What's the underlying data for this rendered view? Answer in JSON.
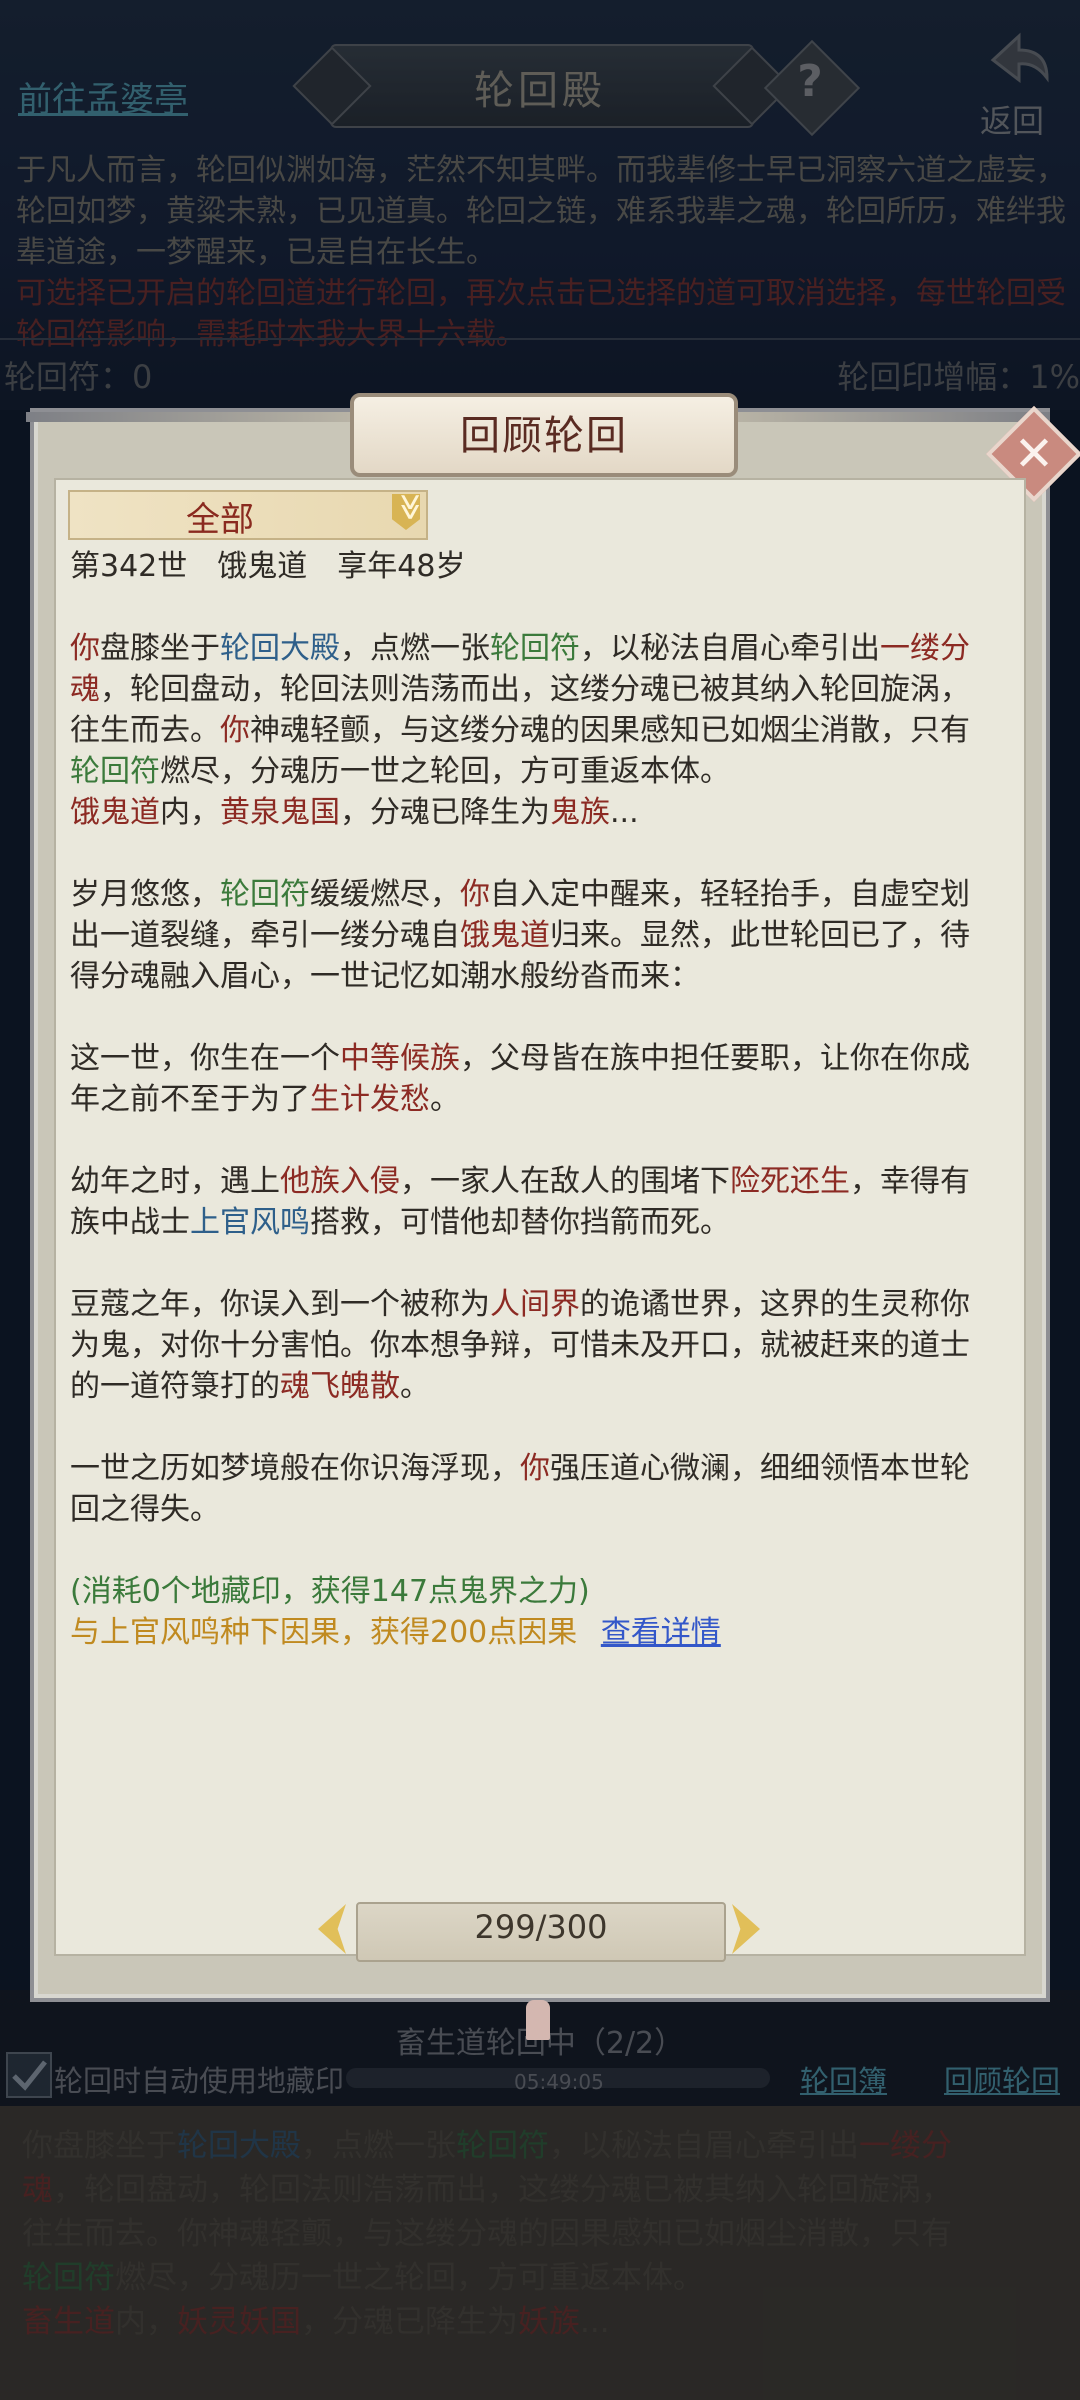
{
  "background": {
    "link_top": "前往孟婆亭",
    "title": "轮回殿",
    "help": "?",
    "back": "返回",
    "intro_line1": "于凡人而言，轮回似渊如海，茫然不知其畔。而我辈修士早已洞察六道之虚妄，",
    "intro_line2": "轮回如梦，黄粱未熟，已见道真。轮回之链，难系我辈之魂，轮回所历，难绊我",
    "intro_line3": "辈道途，一梦醒来，已是自在长生。",
    "intro_red1": "可选择已开启的轮回道进行轮回，再次点击已选择的道可取消选择，每世轮回受",
    "intro_red2": "轮回符影响，需耗时本我大界十六载。",
    "stat_left": "轮回符：0",
    "stat_right": "轮回印增幅：1%",
    "status": "畜生道轮回中（2/2）",
    "auto_label": "轮回时自动使用地藏印",
    "timer": "05:49:05",
    "link_book": "轮回簿",
    "link_review": "回顾轮回",
    "story": [
      "你盘膝坐于",
      "轮回大殿",
      "，点燃一张",
      "轮回符",
      "，以秘法自眉心牵引出",
      "一缕分",
      "魂",
      "，轮回盘动，轮回法则浩荡而出，这缕分魂已被其纳入轮回旋涡，",
      "往生而去。你神魂轻颤，与这缕分魂的因果感知已如烟尘消散，只有",
      "轮回符",
      "燃尽，分魂历一世之轮回，方可重返本体。",
      "畜生道",
      "内，",
      "妖灵妖国",
      "，分魂已降生为",
      "妖族",
      "..."
    ]
  },
  "dialog": {
    "title": "回顾轮回",
    "close": "✕",
    "filter_label": "全部",
    "filter_chevron": "≫",
    "meta": {
      "life": "第342世",
      "path": "饿鬼道",
      "age": "享年48岁"
    },
    "p1": {
      "a1": "你",
      "a2": "盘膝坐于",
      "a3": "轮回大殿",
      "a4": "，点燃一张",
      "a5": "轮回符",
      "a6": "，以秘法自眉心牵引出",
      "a7": "一缕分魂",
      "a8": "，轮回盘动，轮回法则浩荡而出，这缕分魂已被其纳入轮回旋涡，往生而去。",
      "a9": "你",
      "a10": "神魂轻颤，与这缕分魂的因果感知已如烟尘消散，只有",
      "a11": "轮回符",
      "a12": "燃尽，分魂历一世之轮回，方可重返本体。"
    },
    "p1b": {
      "b1": "饿鬼道",
      "b2": "内，",
      "b3": "黄泉鬼国",
      "b4": "，分魂已降生为",
      "b5": "鬼族",
      "b6": "..."
    },
    "p2": {
      "a1": "岁月悠悠，",
      "a2": "轮回符",
      "a3": "缓缓燃尽，",
      "a4": "你",
      "a5": "自入定中醒来，轻轻抬手，自虚空划出一道裂缝，牵引一缕分魂自",
      "a6": "饿鬼道",
      "a7": "归来。显然，此世轮回已了，待得分魂融入眉心，一世记忆如潮水般纷沓而来："
    },
    "p3": {
      "a1": "这一世，你生在一个",
      "a2": "中等候族",
      "a3": "，父母皆在族中担任要职，让你在你成年之前不至于为了",
      "a4": "生计发愁",
      "a5": "。"
    },
    "p4": {
      "a1": "幼年之时，遇上",
      "a2": "他族入侵",
      "a3": "，一家人在敌人的围堵下",
      "a4": "险死还生",
      "a5": "，幸得有族中战士",
      "a6": "上官风鸣",
      "a7": "搭救，可惜他却替你挡箭而死。"
    },
    "p5": {
      "a1": "豆蔻之年，你误入到一个被称为",
      "a2": "人间界",
      "a3": "的诡谲世界，这界的生灵称你为鬼，对你十分害怕。你本想争辩，可惜未及开口，就被赶来的道士的一道符箓打的",
      "a4": "魂飞魄散",
      "a5": "。"
    },
    "p6": {
      "a1": "一世之历如梦境般在你识海浮现，",
      "a2": "你",
      "a3": "强压道心微澜，细细领悟本世轮回之得失。"
    },
    "cost": "(消耗0个地藏印，获得147点鬼界之力)",
    "karma": "与上官风鸣种下因果，获得200点因果",
    "detail_link": "查看详情",
    "pager": "299/300"
  },
  "colors": {
    "red": "#8c2a23",
    "blue": "#2e5f8a",
    "green": "#3b7a3b",
    "orange": "#c08a20",
    "link": "#3357c9"
  }
}
